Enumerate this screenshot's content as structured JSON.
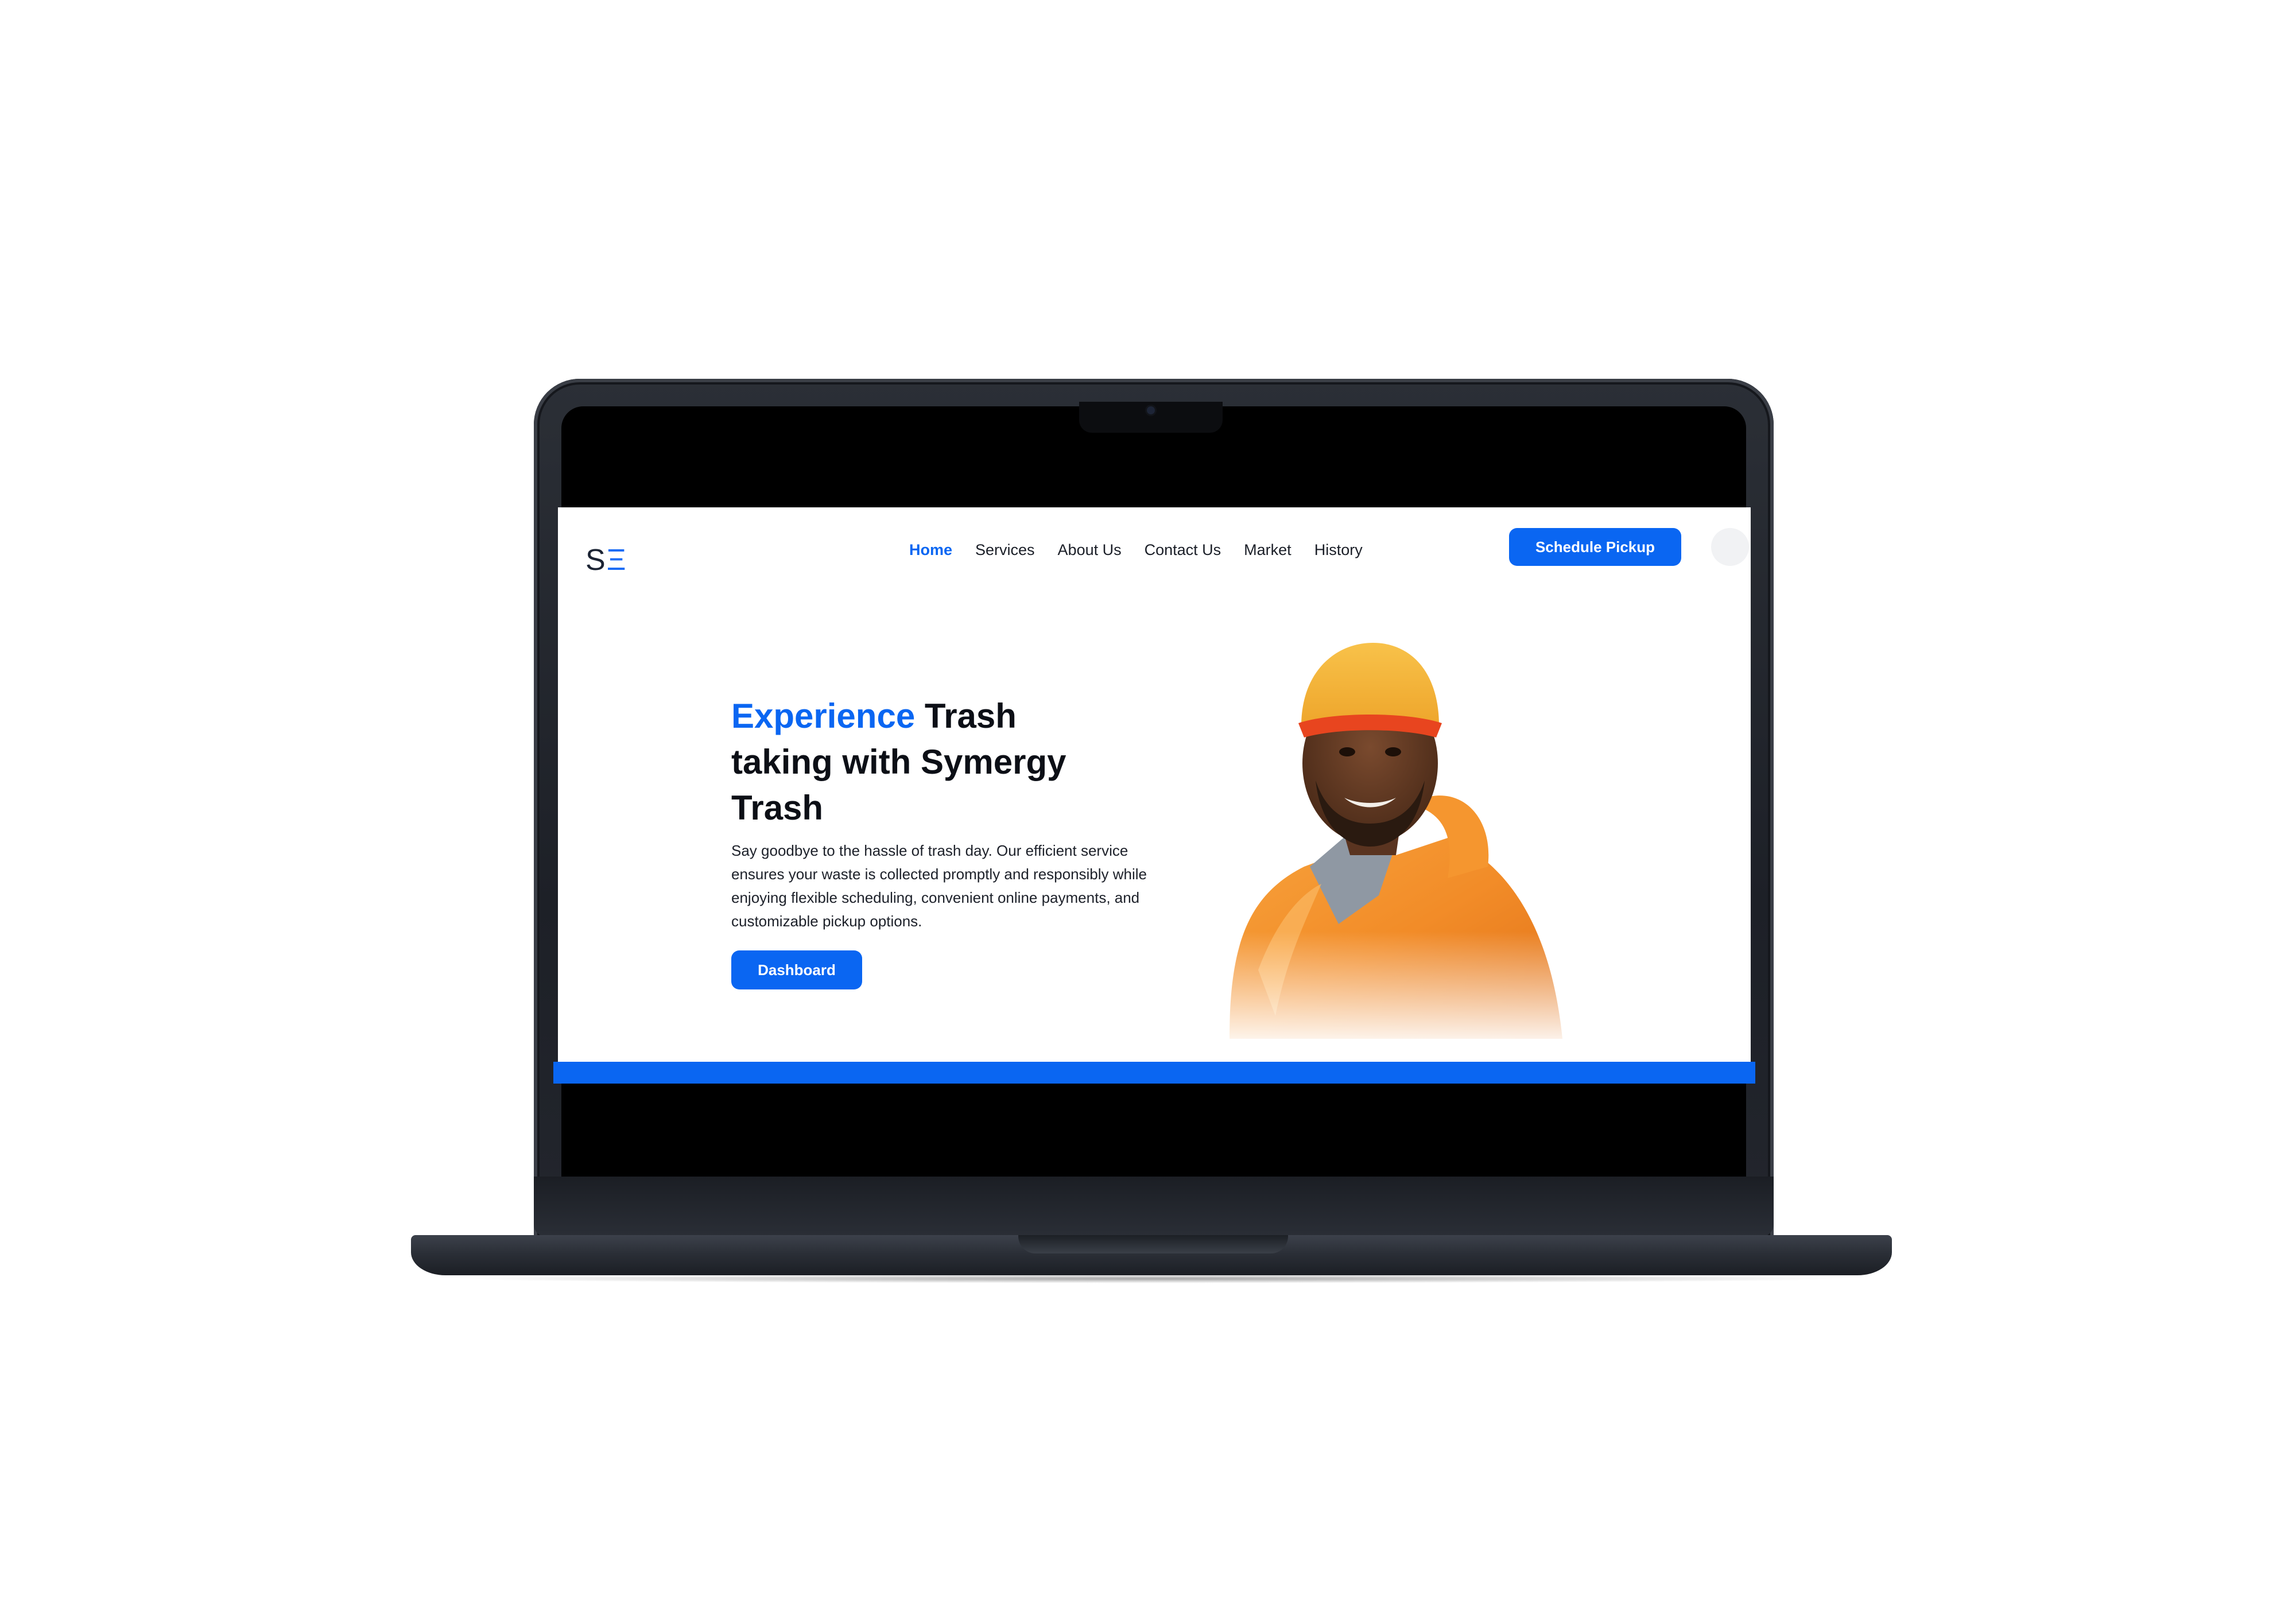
{
  "logo": {
    "first": "S",
    "second": "Ξ"
  },
  "nav": {
    "items": [
      {
        "label": "Home",
        "active": true
      },
      {
        "label": "Services",
        "active": false
      },
      {
        "label": "About Us",
        "active": false
      },
      {
        "label": "Contact Us",
        "active": false
      },
      {
        "label": "Market",
        "active": false
      },
      {
        "label": "History",
        "active": false
      }
    ]
  },
  "header": {
    "cta_label": "Schedule Pickup"
  },
  "hero": {
    "title_accent": "Experience",
    "title_rest": " Trash taking with Symergy Trash",
    "description": "Say goodbye to the hassle of trash day. Our efficient service ensures your waste is collected promptly and responsibly while enjoying flexible scheduling, convenient online payments, and customizable pickup options.",
    "button_label": "Dashboard"
  },
  "colors": {
    "accent": "#0a66f2",
    "text": "#0c0f16",
    "jacket": "#f28c28",
    "cap": "#f5b131"
  },
  "icons": {
    "logo": "se-logo-icon",
    "avatar": "user-avatar-icon"
  }
}
